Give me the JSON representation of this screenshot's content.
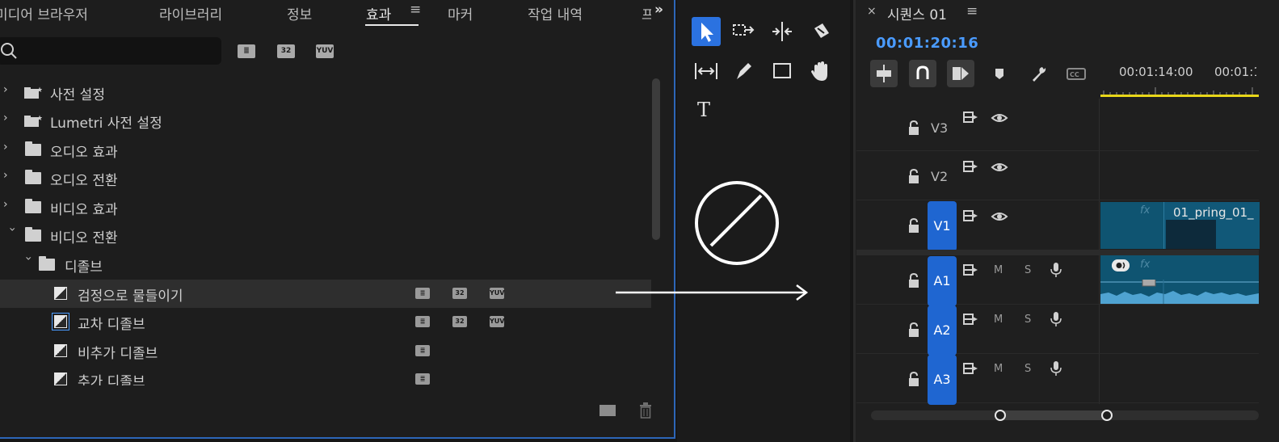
{
  "effects_panel": {
    "tabs": [
      {
        "label": "미디어 브라우저"
      },
      {
        "label": "라이브러리"
      },
      {
        "label": "정보"
      },
      {
        "label": "효과"
      },
      {
        "label": "마커"
      },
      {
        "label": "작업 내역"
      },
      {
        "label": "프"
      }
    ],
    "active_tab": "효과",
    "menu_glyph": "≡",
    "overflow_glyph": "»",
    "search": {
      "value": "",
      "placeholder": ""
    },
    "filter_badges": [
      "≣",
      "32",
      "YUV"
    ],
    "tree": [
      {
        "label": "사전 설정",
        "icon": "preset-folder-icon",
        "expanded": false
      },
      {
        "label": "Lumetri 사전 설정",
        "icon": "preset-folder-icon",
        "expanded": false
      },
      {
        "label": "오디오 효과",
        "icon": "folder-icon",
        "expanded": false
      },
      {
        "label": "오디오 전환",
        "icon": "folder-icon",
        "expanded": false
      },
      {
        "label": "비디오 효과",
        "icon": "folder-icon",
        "expanded": false
      },
      {
        "label": "비디오 전환",
        "icon": "folder-icon",
        "expanded": true
      },
      {
        "label": "디졸브",
        "icon": "folder-icon",
        "expanded": true
      },
      {
        "label": "검정으로 물들이기",
        "icon": "transition-icon",
        "badges": [
          "≣",
          "32",
          "YUV"
        ],
        "selected": true
      },
      {
        "label": "교차 디졸브",
        "icon": "transition-icon",
        "badges": [
          "≣",
          "32",
          "YUV"
        ]
      },
      {
        "label": "비추가 디졸브",
        "icon": "transition-icon",
        "badges": [
          "≣"
        ]
      },
      {
        "label": "추가 디졸브",
        "icon": "transition-icon",
        "badges": [
          "≣"
        ]
      }
    ]
  },
  "tools_panel": {
    "tools": [
      {
        "name": "selection-tool",
        "active": true
      },
      {
        "name": "track-select-tool"
      },
      {
        "name": "ripple-edit-tool"
      },
      {
        "name": "razor-tool"
      },
      {
        "name": "slip-tool"
      },
      {
        "name": "pen-tool"
      },
      {
        "name": "rectangle-tool"
      },
      {
        "name": "hand-tool"
      },
      {
        "name": "type-tool",
        "glyph": "T"
      }
    ]
  },
  "overlay": {
    "icon": "no-symbol-icon",
    "arrow": "right-arrow-icon"
  },
  "timeline": {
    "close_glyph": "×",
    "title": "시퀀스 01",
    "menu_glyph": "≡",
    "timecode": "00:01:20:16",
    "ruler_times": [
      "00:01:14:00",
      "00:01:1"
    ],
    "colors": {
      "accent": "#1f66d1",
      "timecode": "#4a9bff",
      "clip": "#0f5471",
      "playbar": "#e8d619"
    },
    "video_tracks": [
      {
        "name": "V3",
        "targeted": false
      },
      {
        "name": "V2",
        "targeted": false
      },
      {
        "name": "V1",
        "targeted": true
      }
    ],
    "audio_tracks": [
      {
        "name": "A1",
        "m": "M",
        "s": "S"
      },
      {
        "name": "A2",
        "m": "M",
        "s": "S"
      },
      {
        "name": "A3",
        "m": "M",
        "s": "S"
      }
    ],
    "clip": {
      "name": "01_pring_01_",
      "fx": "fx"
    }
  }
}
